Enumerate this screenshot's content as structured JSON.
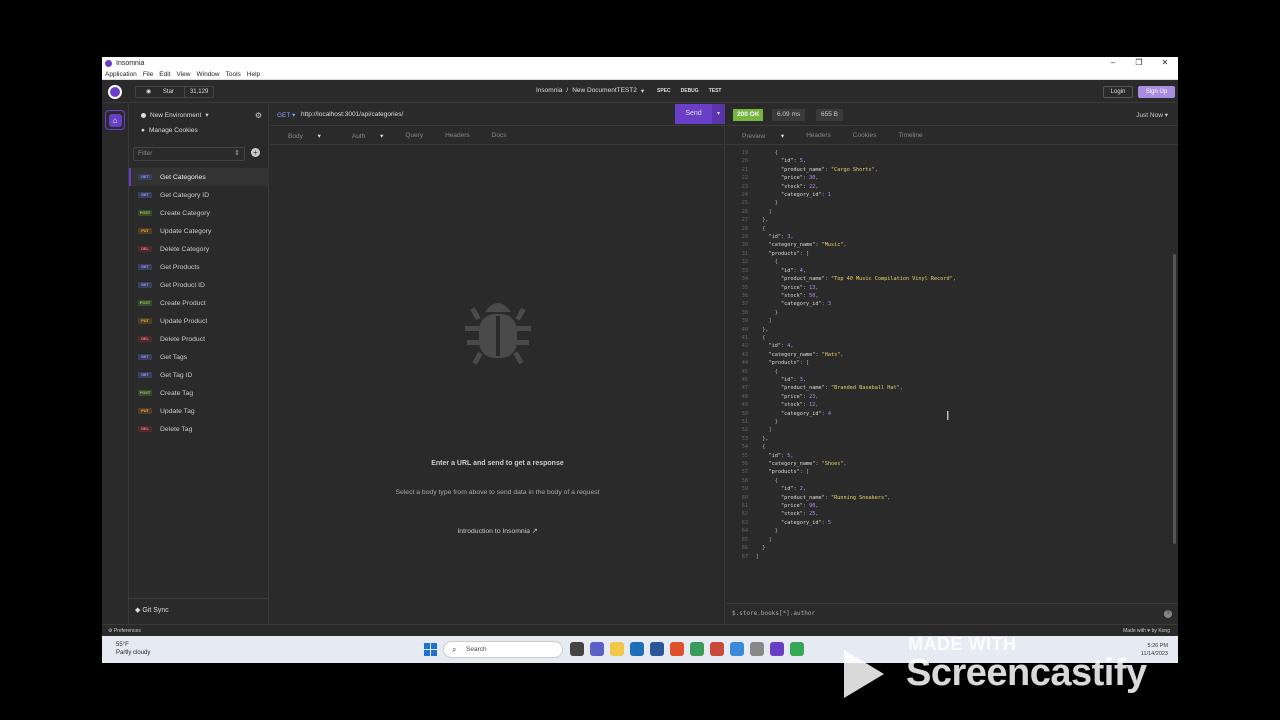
{
  "window": {
    "title": "Insomnia"
  },
  "menu": [
    "Application",
    "File",
    "Edit",
    "View",
    "Window",
    "Tools",
    "Help"
  ],
  "topbar": {
    "star_label": "Star",
    "star_count": "31,129",
    "project": "Insomnia",
    "separator": "/",
    "document": "New DocumentTEST2",
    "tabs": [
      "SPEC",
      "DEBUG",
      "TEST"
    ],
    "login": "Login",
    "signup": "Sign Up"
  },
  "sidebar": {
    "environment": "New Environment",
    "manage_cookies": "Manage Cookies",
    "filter_placeholder": "Filter",
    "requests": [
      {
        "method": "GET",
        "name": "Get Categories"
      },
      {
        "method": "GET",
        "name": "Get Category ID"
      },
      {
        "method": "POST",
        "name": "Create Category"
      },
      {
        "method": "PUT",
        "name": "Update Category"
      },
      {
        "method": "DEL",
        "name": "Delete Category"
      },
      {
        "method": "GET",
        "name": "Get Products"
      },
      {
        "method": "GET",
        "name": "Get Product ID"
      },
      {
        "method": "POST",
        "name": "Create Product"
      },
      {
        "method": "PUT",
        "name": "Update Product"
      },
      {
        "method": "DEL",
        "name": "Delete Product"
      },
      {
        "method": "GET",
        "name": "Get Tags"
      },
      {
        "method": "GET",
        "name": "Get Tag ID"
      },
      {
        "method": "POST",
        "name": "Create Tag"
      },
      {
        "method": "PUT",
        "name": "Update Tag"
      },
      {
        "method": "DEL",
        "name": "Delete Tag"
      }
    ],
    "git_sync": "Git Sync"
  },
  "request": {
    "method": "GET",
    "url": "http://localhost:3001/api/categories/",
    "send": "Send",
    "tabs": [
      "Body",
      "Auth",
      "Query",
      "Headers",
      "Docs"
    ],
    "empty_title": "Enter a URL and send to get a response",
    "empty_sub": "Select a body type from above to send data in the body of a request",
    "intro_link": "Introduction to Insomnia"
  },
  "response": {
    "status": "200 OK",
    "time": "6.09 ms",
    "size": "655 B",
    "when": "Just Now",
    "tabs": [
      "Preview",
      "Headers",
      "Cookies",
      "Timeline"
    ],
    "jsonpath_placeholder": "$.store.books[*].author",
    "lines": [
      {
        "n": "19",
        "t": "      {"
      },
      {
        "n": "20",
        "t": "        \"id\": 5,"
      },
      {
        "n": "21",
        "t": "        \"product_name\": \"Cargo Shorts\","
      },
      {
        "n": "22",
        "t": "        \"price\": 30,"
      },
      {
        "n": "23",
        "t": "        \"stock\": 22,"
      },
      {
        "n": "24",
        "t": "        \"category_id\": 1"
      },
      {
        "n": "25",
        "t": "      }"
      },
      {
        "n": "26",
        "t": "    ]"
      },
      {
        "n": "27",
        "t": "  },"
      },
      {
        "n": "28",
        "t": "  {"
      },
      {
        "n": "29",
        "t": "    \"id\": 3,"
      },
      {
        "n": "30",
        "t": "    \"category_name\": \"Music\","
      },
      {
        "n": "31",
        "t": "    \"products\": ["
      },
      {
        "n": "32",
        "t": "      {"
      },
      {
        "n": "33",
        "t": "        \"id\": 4,"
      },
      {
        "n": "34",
        "t": "        \"product_name\": \"Top 40 Music Compilation Vinyl Record\","
      },
      {
        "n": "35",
        "t": "        \"price\": 13,"
      },
      {
        "n": "36",
        "t": "        \"stock\": 50,"
      },
      {
        "n": "37",
        "t": "        \"category_id\": 3"
      },
      {
        "n": "38",
        "t": "      }"
      },
      {
        "n": "39",
        "t": "    ]"
      },
      {
        "n": "40",
        "t": "  },"
      },
      {
        "n": "41",
        "t": "  {"
      },
      {
        "n": "42",
        "t": "    \"id\": 4,"
      },
      {
        "n": "43",
        "t": "    \"category_name\": \"Hats\","
      },
      {
        "n": "44",
        "t": "    \"products\": ["
      },
      {
        "n": "45",
        "t": "      {"
      },
      {
        "n": "46",
        "t": "        \"id\": 3,"
      },
      {
        "n": "47",
        "t": "        \"product_name\": \"Branded Baseball Hat\","
      },
      {
        "n": "48",
        "t": "        \"price\": 23,"
      },
      {
        "n": "49",
        "t": "        \"stock\": 12,"
      },
      {
        "n": "50",
        "t": "        \"category_id\": 4"
      },
      {
        "n": "51",
        "t": "      }"
      },
      {
        "n": "52",
        "t": "    ]"
      },
      {
        "n": "53",
        "t": "  },"
      },
      {
        "n": "54",
        "t": "  {"
      },
      {
        "n": "55",
        "t": "    \"id\": 5,"
      },
      {
        "n": "56",
        "t": "    \"category_name\": \"Shoes\","
      },
      {
        "n": "57",
        "t": "    \"products\": ["
      },
      {
        "n": "58",
        "t": "      {"
      },
      {
        "n": "59",
        "t": "        \"id\": 2,"
      },
      {
        "n": "60",
        "t": "        \"product_name\": \"Running Sneakers\","
      },
      {
        "n": "61",
        "t": "        \"price\": 90,"
      },
      {
        "n": "62",
        "t": "        \"stock\": 25,"
      },
      {
        "n": "63",
        "t": "        \"category_id\": 5"
      },
      {
        "n": "64",
        "t": "      }"
      },
      {
        "n": "65",
        "t": "    ]"
      },
      {
        "n": "66",
        "t": "  }"
      },
      {
        "n": "67",
        "t": "]"
      }
    ]
  },
  "footer": {
    "preferences": "Preferences",
    "made_with": "Made with ♥ by Kong"
  },
  "taskbar": {
    "temp": "55°F",
    "weather": "Partly cloudy",
    "search": "Search",
    "time": "5:26 PM",
    "date": "11/14/2023"
  },
  "watermark": {
    "line1": "MADE WITH",
    "line2": "Screencastify"
  },
  "colors": {
    "accent": "#6a3fc7",
    "ok": "#78b441",
    "get": "#8aa0ff",
    "post": "#8ed15a",
    "put": "#ffa94d",
    "delete": "#ff7a7a"
  }
}
